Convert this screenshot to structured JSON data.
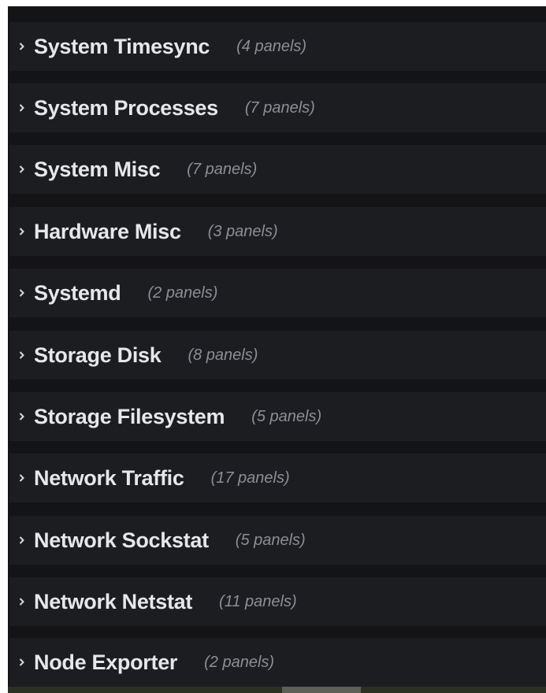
{
  "rows": [
    {
      "title": "System Timesync",
      "count": "(4 panels)",
      "icon": "chevron-right-icon"
    },
    {
      "title": "System Processes",
      "count": "(7 panels)",
      "icon": "chevron-right-icon"
    },
    {
      "title": "System Misc",
      "count": "(7 panels)",
      "icon": "chevron-right-icon"
    },
    {
      "title": "Hardware Misc",
      "count": "(3 panels)",
      "icon": "chevron-right-icon"
    },
    {
      "title": "Systemd",
      "count": "(2 panels)",
      "icon": "chevron-right-icon"
    },
    {
      "title": "Storage Disk",
      "count": "(8 panels)",
      "icon": "chevron-right-icon"
    },
    {
      "title": "Storage Filesystem",
      "count": "(5 panels)",
      "icon": "chevron-right-icon"
    },
    {
      "title": "Network Traffic",
      "count": "(17 panels)",
      "icon": "chevron-right-icon"
    },
    {
      "title": "Network Sockstat",
      "count": "(5 panels)",
      "icon": "chevron-right-icon"
    },
    {
      "title": "Network Netstat",
      "count": "(11 panels)",
      "icon": "chevron-right-icon"
    },
    {
      "title": "Node Exporter",
      "count": "(2 panels)",
      "icon": "chevron-right-icon"
    }
  ],
  "colors": {
    "background": "#141417",
    "row_background": "#1c1d21",
    "title": "#e6e7e9",
    "count": "#8c8e95"
  }
}
